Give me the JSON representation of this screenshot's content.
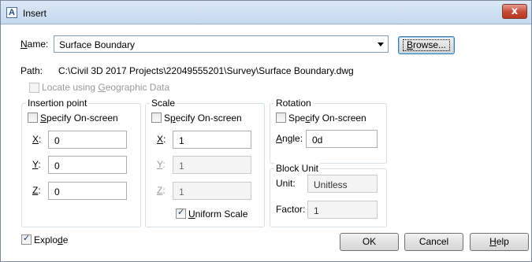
{
  "window": {
    "title": "Insert",
    "close_glyph": "x"
  },
  "name_row": {
    "label_prefix": "N",
    "label_rest": "ame:",
    "value": "Surface Boundary",
    "browse_prefix": "B",
    "browse_rest": "rowse..."
  },
  "path": {
    "label": "Path:",
    "value": "C:\\Civil 3D 2017 Projects\\22049555201\\Survey\\Surface Boundary.dwg"
  },
  "geo": {
    "pre": "Locate using ",
    "accel": "G",
    "post": "eographic Data"
  },
  "insertion": {
    "title": "Insertion point",
    "specify": {
      "accel": "S",
      "rest": "pecify On-screen"
    },
    "x": {
      "accel": "X",
      "colon": ":",
      "value": "0"
    },
    "y": {
      "accel": "Y",
      "colon": ":",
      "value": "0"
    },
    "z": {
      "accel": "Z",
      "colon": ":",
      "value": "0"
    }
  },
  "scale": {
    "title": "Scale",
    "specify": {
      "pre": "S",
      "accel": "p",
      "rest": "ecify On-screen"
    },
    "x": {
      "accel": "X",
      "colon": ":",
      "value": "1"
    },
    "y": {
      "accel": "Y",
      "colon": ":",
      "value": "1"
    },
    "z": {
      "accel": "Z",
      "colon": ":",
      "value": "1"
    },
    "uniform": {
      "accel": "U",
      "rest": "niform Scale",
      "checked": true
    }
  },
  "rotation": {
    "title": "Rotation",
    "specify": {
      "pre": "Spe",
      "accel": "c",
      "rest": "ify On-screen"
    },
    "angle": {
      "accel": "A",
      "rest": "ngle:",
      "value": "0d"
    }
  },
  "block_unit": {
    "title": "Block Unit",
    "unit_label": "Unit:",
    "unit_value": "Unitless",
    "factor_label": "Factor:",
    "factor_value": "1"
  },
  "explode": {
    "pre": "Explo",
    "accel": "d",
    "rest": "e",
    "checked": true
  },
  "buttons": {
    "ok": "OK",
    "cancel": "Cancel",
    "help_accel": "H",
    "help_rest": "elp"
  },
  "colors": {
    "accent_border": "#3c7fb1",
    "group_border": "#d5dfe5",
    "close_red": "#c54a35"
  },
  "icons": {
    "app": "autocad-a-icon",
    "close": "close-icon",
    "dropdown": "chevron-down-icon",
    "check": "checkmark-icon"
  }
}
